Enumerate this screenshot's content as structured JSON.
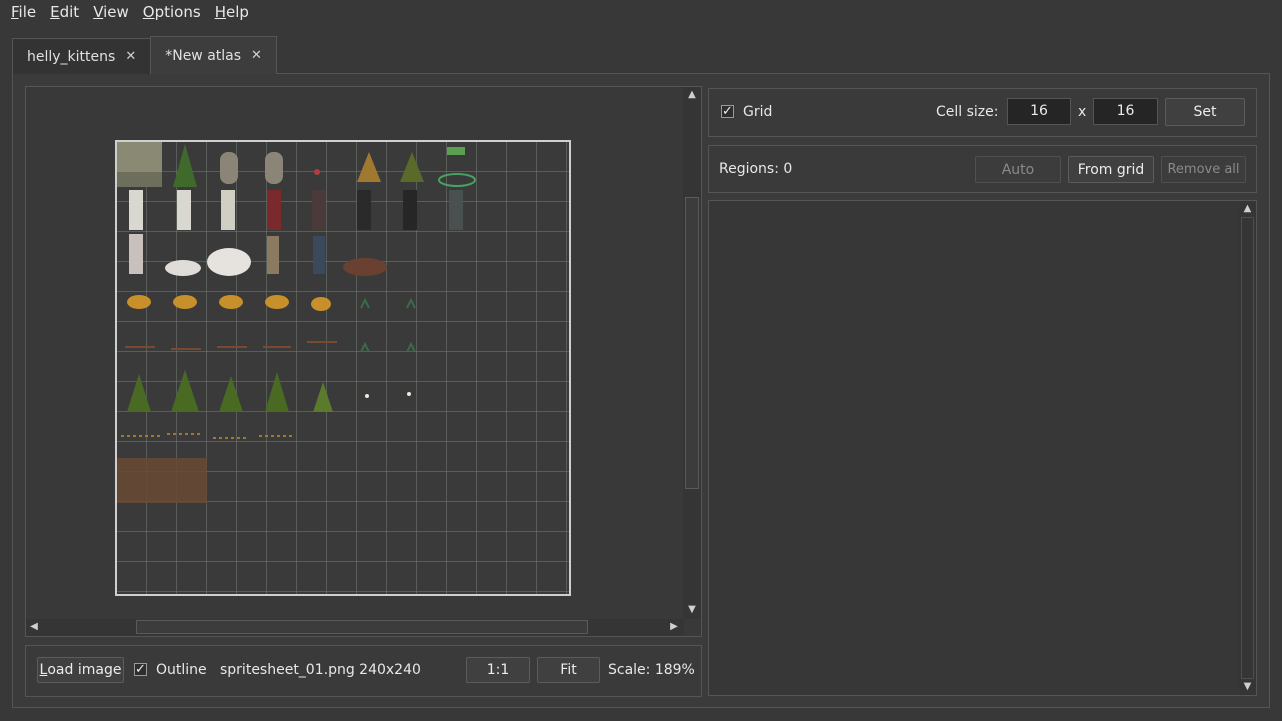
{
  "menu": {
    "items": [
      {
        "label": "File",
        "u": "F",
        "rest": "ile"
      },
      {
        "label": "Edit",
        "u": "E",
        "rest": "dit"
      },
      {
        "label": "View",
        "u": "V",
        "rest": "iew"
      },
      {
        "label": "Options",
        "u": "O",
        "rest": "ptions"
      },
      {
        "label": "Help",
        "u": "H",
        "rest": "elp"
      }
    ]
  },
  "tabs": [
    {
      "label": "helly_kittens",
      "close": "✕"
    },
    {
      "label": "*New atlas",
      "close": "✕"
    }
  ],
  "grid_panel": {
    "grid_label": "Grid",
    "grid_checked": true,
    "cell_size_label": "Cell size:",
    "cell_w": "16",
    "times": "x",
    "cell_h": "16",
    "set_label": "Set"
  },
  "regions_panel": {
    "regions_text": "Regions: 0",
    "auto_label": "Auto",
    "from_grid_label": "From grid",
    "remove_all_label": "Remove all"
  },
  "bottom_bar": {
    "load_image_u": "L",
    "load_image_rest": "oad image",
    "outline_label": "Outline",
    "outline_checked": true,
    "file_info": "spritesheet_01.png 240x240",
    "one_to_one_label": "1:1",
    "fit_label": "Fit",
    "scale_text": "Scale: 189%"
  },
  "icons": {
    "check": "✓",
    "arrow_up": "▲",
    "arrow_down": "▼",
    "arrow_left": "◀",
    "arrow_right": "▶"
  },
  "colors": {
    "background": "#383838",
    "panel": "#3a3a3a",
    "field": "#252525",
    "border": "#555555",
    "text": "#e8e8e8"
  }
}
